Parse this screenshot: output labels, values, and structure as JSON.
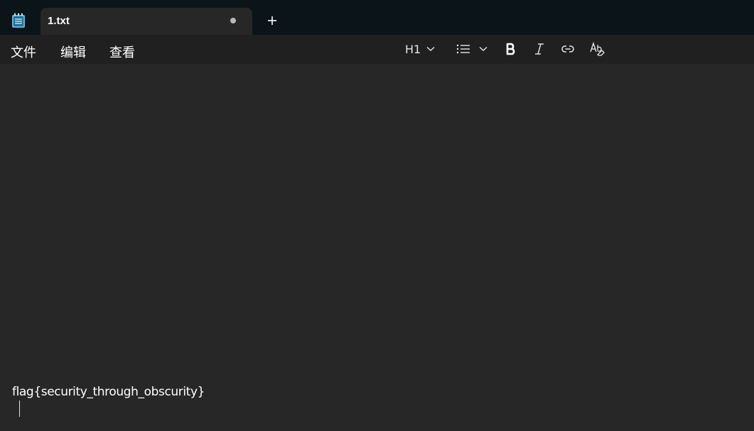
{
  "tab": {
    "title": "1.txt"
  },
  "menu": {
    "file": "文件",
    "edit": "编辑",
    "view": "查看"
  },
  "toolbar": {
    "heading": "H1"
  },
  "editor": {
    "content": "flag{security_through_obscurity}"
  },
  "colors": {
    "background": "#272727",
    "titlebar": "#0b1418",
    "toolbar": "#202020",
    "icon_accent": "#4fb8e8"
  }
}
